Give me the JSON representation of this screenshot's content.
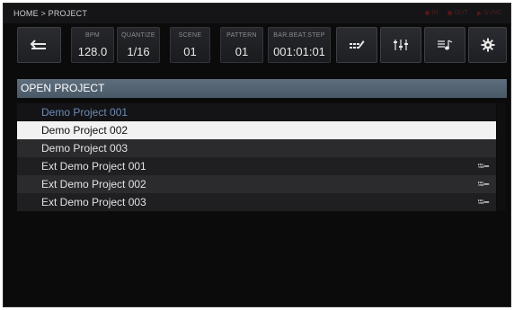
{
  "breadcrumb": "HOME > PROJECT",
  "status": {
    "in": "IN",
    "out": "OUT",
    "sync": "SYNC"
  },
  "toolbar": {
    "bpm": {
      "label": "BPM",
      "value": "128.0"
    },
    "quantize": {
      "label": "QUANTIZE",
      "value": "1/16"
    },
    "scene": {
      "label": "SCENE",
      "value": "01"
    },
    "pattern": {
      "label": "PATTERN",
      "value": "01"
    },
    "position": {
      "label": "BAR.BEAT.STEP",
      "value": "001:01:01"
    }
  },
  "section_title": "OPEN PROJECT",
  "projects": [
    {
      "name": "Demo Project 001",
      "state": "dim",
      "usb": false
    },
    {
      "name": "Demo Project 002",
      "state": "selected",
      "usb": false
    },
    {
      "name": "Demo Project 003",
      "state": "normal",
      "usb": false
    },
    {
      "name": "Ext Demo Project 001",
      "state": "normal",
      "usb": true
    },
    {
      "name": "Ext Demo Project 002",
      "state": "normal",
      "usb": true
    },
    {
      "name": "Ext Demo Project 003",
      "state": "normal",
      "usb": true
    }
  ],
  "icons": {
    "back": "back-arrow-icon",
    "sequence": "sequence-edit-icon",
    "mixer": "mixer-sliders-icon",
    "sound": "sound-browse-icon",
    "settings": "gear-icon",
    "usb": "usb-icon"
  },
  "colors": {
    "header": "#53626f",
    "selected_row": "#f2f2f2",
    "dim_text": "#6b8bb3",
    "background": "#0b0b0c"
  }
}
